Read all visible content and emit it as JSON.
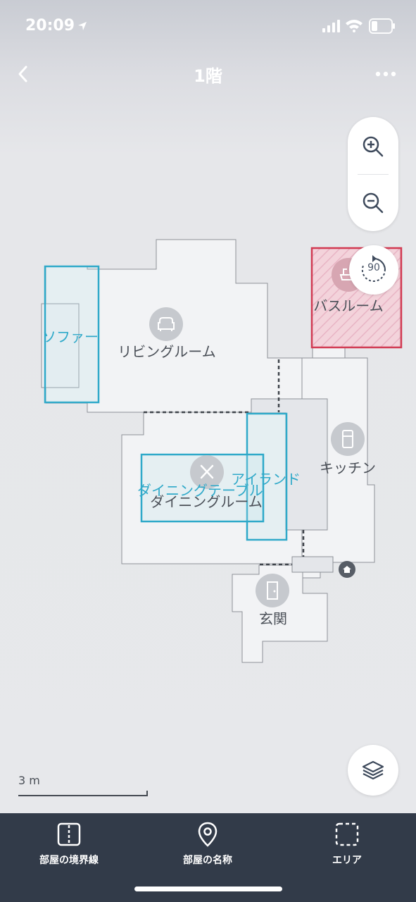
{
  "status_bar": {
    "time": "20:09"
  },
  "nav": {
    "title": "1階"
  },
  "controls": {
    "rotate_label": "90"
  },
  "rooms": {
    "living": "リビングルーム",
    "bath": "バスルーム",
    "kitchen": "キッチン",
    "dining": "ダイニングルーム",
    "entrance": "玄関"
  },
  "furniture": {
    "sofa": "ソファー",
    "island": "アイランド",
    "dining_table": "ダイニングテーブル"
  },
  "scale": {
    "label": "3 m"
  },
  "toolbar": {
    "boundary": "部屋の境界線",
    "room_name": "部屋の名称",
    "area": "エリア"
  },
  "colors": {
    "furniture_outline": "#2fa9c9",
    "no_go_zone": "#d23a52",
    "toolbar_bg": "#323b49"
  }
}
